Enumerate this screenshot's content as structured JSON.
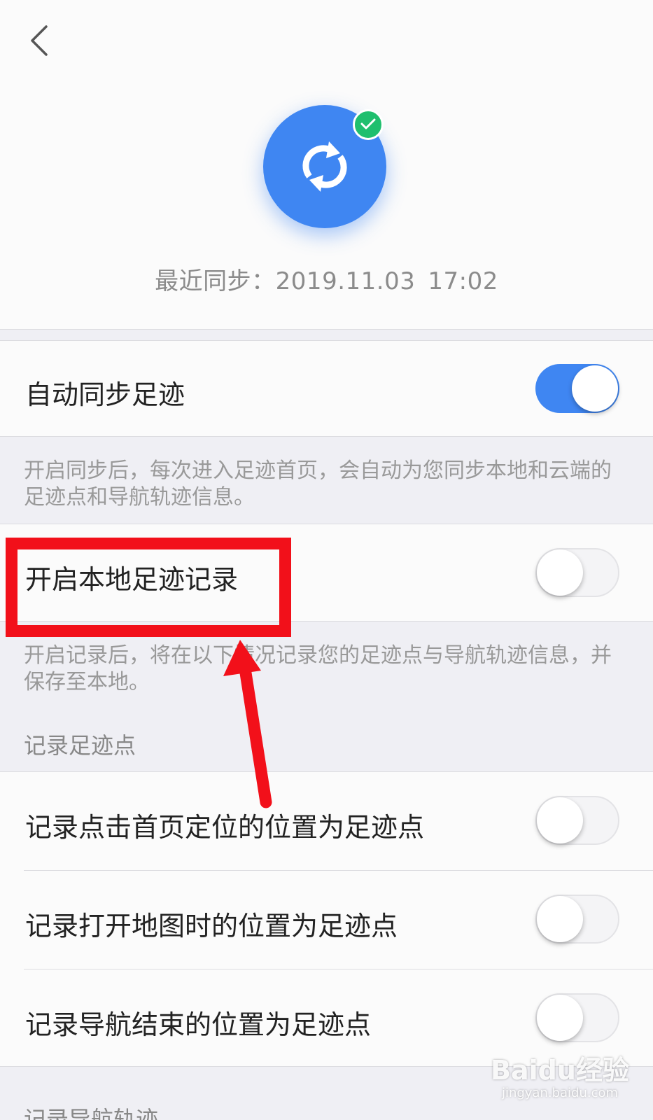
{
  "header": {
    "back_icon": "chevron-left-icon",
    "sync_icon": "sync-icon",
    "badge_icon": "check-icon",
    "last_sync_label": "最近同步：",
    "last_sync_date": "2019.11.03",
    "last_sync_time": "17:02"
  },
  "colors": {
    "accent": "#3f86f2",
    "badge": "#1fbf6e",
    "annotation": "#f2101a"
  },
  "auto_sync": {
    "label": "自动同步足迹",
    "enabled": true,
    "description": "开启同步后，每次进入足迹首页，会自动为您同步本地和云端的足迹点和导航轨迹信息。"
  },
  "local_record": {
    "label": "开启本地足迹记录",
    "enabled": false,
    "description": "开启记录后，将在以下情况记录您的足迹点与导航轨迹信息，并保存至本地。"
  },
  "record_points": {
    "section_title": "记录足迹点",
    "items": [
      {
        "label": "记录点击首页定位的位置为足迹点",
        "enabled": false
      },
      {
        "label": "记录打开地图时的位置为足迹点",
        "enabled": false
      },
      {
        "label": "记录导航结束的位置为足迹点",
        "enabled": false
      }
    ]
  },
  "record_tracks": {
    "section_title": "记录导航轨迹"
  },
  "watermark": {
    "brand": "Baidu经验",
    "url": "jingyan.baidu.com"
  }
}
